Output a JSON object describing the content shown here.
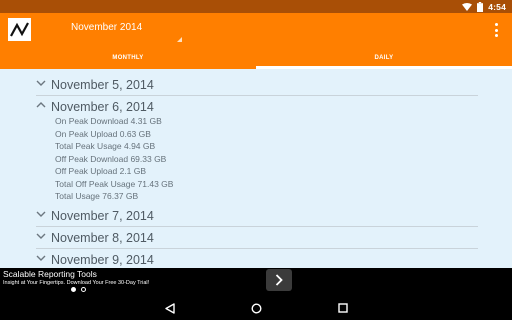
{
  "status_bar": {
    "time": "4:54",
    "icons": [
      "wifi-icon",
      "battery-icon"
    ]
  },
  "app_bar": {
    "logo_icon": "line-chart-logo",
    "month_selector": "November 2014",
    "overflow_icon": "more-vertical-icon"
  },
  "tabs": [
    {
      "label": "MONTHLY",
      "active": false
    },
    {
      "label": "DAILY",
      "active": true
    }
  ],
  "days": [
    {
      "label": "November 5, 2014",
      "expanded": false
    },
    {
      "label": "November 6, 2014",
      "expanded": true,
      "stats": [
        "On Peak Download 4.31 GB",
        "On Peak Upload 0.63 GB",
        "Total Peak Usage 4.94 GB",
        "Off Peak Download 69.33 GB",
        "Off Peak Upload 2.1 GB",
        "Total Off Peak Usage 71.43 GB",
        "Total Usage 76.37 GB"
      ]
    },
    {
      "label": "November 7, 2014",
      "expanded": false
    },
    {
      "label": "November 8, 2014",
      "expanded": false
    },
    {
      "label": "November 9, 2014",
      "expanded": false
    }
  ],
  "ad": {
    "title": "Scalable Reporting Tools",
    "subtitle": "Insight at Your Fingertips. Download Your Free 30-Day Trial!",
    "button_icon": "chevron-right-icon"
  },
  "nav_bar": {
    "icons": [
      "back-icon",
      "home-icon",
      "recents-icon"
    ]
  },
  "colors": {
    "status_bar": "#a94f06",
    "app_bar": "#ff7f00",
    "background": "#e3f2fb",
    "text": "#4f5a63"
  }
}
